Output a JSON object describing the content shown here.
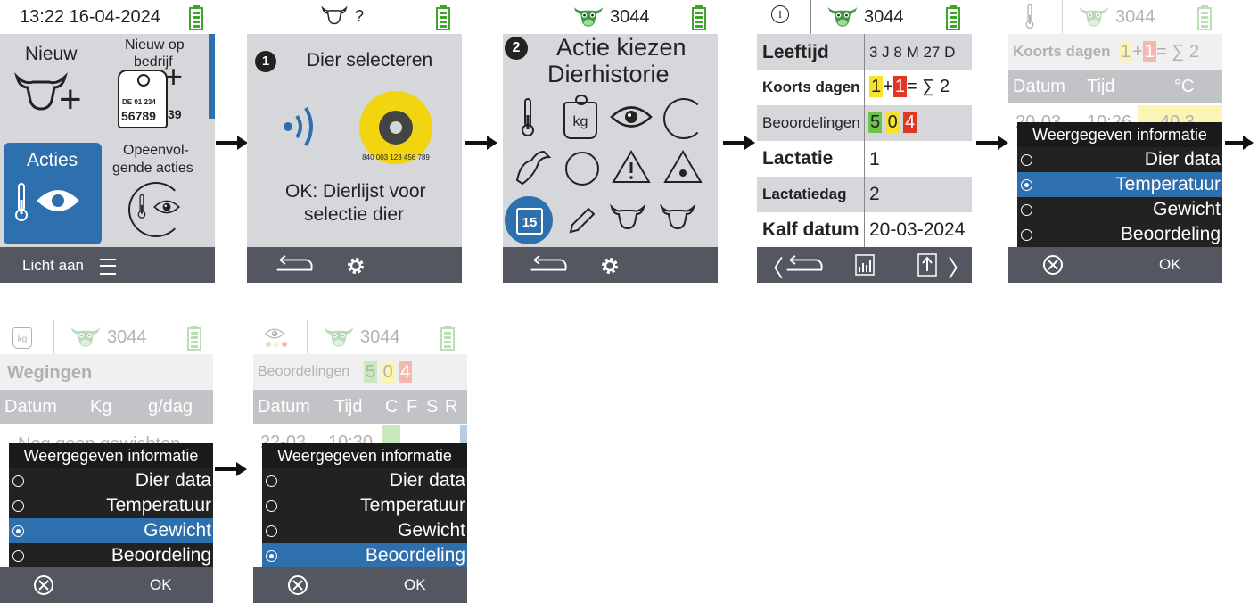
{
  "screen1": {
    "time": "13:22 16-04-2024",
    "tile_new": "Nieuw",
    "tile_new_company_1": "Nieuw op",
    "tile_new_company_2": "bedrijf",
    "tag_small": "DE 01 234",
    "tag_big": "56789",
    "tag_side": "39",
    "tile_actions": "Acties",
    "tile_next_1": "Opeenvol-",
    "tile_next_2": "gende acties",
    "footer_light": "Licht aan"
  },
  "screen2": {
    "hdr_text": "?",
    "step": "1",
    "title": "Dier selecteren",
    "tag_number": "840 003 123 456 789",
    "ok_text_1": "OK: Dierlijst voor",
    "ok_text_2": "selectie dier"
  },
  "screen3": {
    "animal": "3044",
    "step": "2",
    "title_1": "Actie kiezen",
    "title_2": "Dierhistorie",
    "kg": "kg",
    "calendar_day": "15"
  },
  "screen4": {
    "animal": "3044",
    "rows": [
      {
        "label": "Leeftijd",
        "value": "3 J 8 M 27 D"
      },
      {
        "label": "Koorts dagen",
        "value": ""
      },
      {
        "label": "Beoordelingen",
        "value": ""
      },
      {
        "label": "Lactatie",
        "value": "1"
      },
      {
        "label": "Lactatiedag",
        "value": "2"
      },
      {
        "label": "Kalf datum",
        "value": "20-03-2024"
      }
    ],
    "fever_a": "1",
    "fever_plus": "+",
    "fever_b": "1",
    "fever_eq": "= ∑ 2",
    "score_a": "5",
    "score_b": "0",
    "score_c": "4"
  },
  "screen5": {
    "animal": "3044",
    "koorts_label": "Koorts dagen",
    "fever_a": "1",
    "fever_plus": "+",
    "fever_b": "1",
    "fever_eq": "= ∑ 2",
    "col_date": "Datum",
    "col_time": "Tijd",
    "col_unit": "°C",
    "row_date": "20-03",
    "row_time": "10:26",
    "row_val": "40,3",
    "dialog_title": "Weergegeven informatie",
    "options": [
      "Dier data",
      "Temperatuur",
      "Gewicht",
      "Beoordeling"
    ],
    "ok": "OK"
  },
  "screen6": {
    "animal": "3044",
    "kg": "kg",
    "title": "Wegingen",
    "col_date": "Datum",
    "col_kg": "Kg",
    "col_gday": "g/dag",
    "empty_text": "Nog geen gewichten",
    "dialog_title": "Weergegeven informatie",
    "options": [
      "Dier data",
      "Temperatuur",
      "Gewicht",
      "Beoordeling"
    ],
    "ok": "OK"
  },
  "screen7": {
    "animal": "3044",
    "label": "Beoordelingen",
    "score_a": "5",
    "score_b": "0",
    "score_c": "4",
    "col_date": "Datum",
    "col_time": "Tijd",
    "col_c": "C",
    "col_f": "F",
    "col_s": "S",
    "col_r": "R",
    "row_date": "22-03",
    "row_time": "10:30",
    "dialog_title": "Weergegeven informatie",
    "options": [
      "Dier data",
      "Temperatuur",
      "Gewicht",
      "Beoordeling"
    ],
    "ok": "OK"
  },
  "colors": {
    "panel": "#d6d7da",
    "footer": "#54575f",
    "accent": "#2e6fad",
    "battery": "#3fa62b",
    "fever_yellow": "#f7e12a",
    "fever_red": "#e33620",
    "score_green": "#6cc24a"
  },
  "icons": [
    "battery-icon",
    "cow-head-icon",
    "ear-tag-icon",
    "rfid-icon",
    "thermometer-icon",
    "weight-icon",
    "eye-icon",
    "calendar-icon",
    "pencil-icon",
    "settings-icon",
    "back-icon",
    "menu-icon",
    "cancel-icon",
    "chart-icon",
    "upload-icon",
    "stork-icon",
    "warning-icon"
  ]
}
